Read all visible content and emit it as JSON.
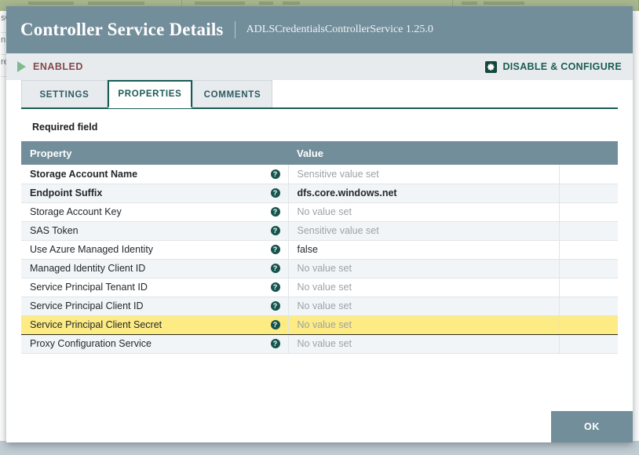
{
  "background": {
    "side_labels": [
      "sC",
      "n",
      "re"
    ],
    "topbar_color": "#a9b78f"
  },
  "modal": {
    "title": "Controller Service Details",
    "subtitle": "ADLSCredentialsControllerService 1.25.0",
    "header_color": "#728e9b"
  },
  "status": {
    "state_label": "ENABLED",
    "state_color": "#84494b",
    "play_icon": "play-triangle-icon",
    "action_label": "DISABLE & CONFIGURE",
    "action_icon": "gear-icon",
    "action_color": "#1d5b55"
  },
  "tabs": [
    {
      "label": "SETTINGS",
      "active": false
    },
    {
      "label": "PROPERTIES",
      "active": true
    },
    {
      "label": "COMMENTS",
      "active": false
    }
  ],
  "content": {
    "required_note": "Required field",
    "table": {
      "headers": [
        "Property",
        "Value",
        ""
      ],
      "help_icon_glyph": "?",
      "rows": [
        {
          "property": "Storage Account Name",
          "required": true,
          "value": "Sensitive value set",
          "value_state": "unset",
          "selected": false
        },
        {
          "property": "Endpoint Suffix",
          "required": true,
          "value": "dfs.core.windows.net",
          "value_state": "bold",
          "selected": false
        },
        {
          "property": "Storage Account Key",
          "required": false,
          "value": "No value set",
          "value_state": "unset",
          "selected": false
        },
        {
          "property": "SAS Token",
          "required": false,
          "value": "Sensitive value set",
          "value_state": "unset",
          "selected": false
        },
        {
          "property": "Use Azure Managed Identity",
          "required": false,
          "value": "false",
          "value_state": "normal",
          "selected": false
        },
        {
          "property": "Managed Identity Client ID",
          "required": false,
          "value": "No value set",
          "value_state": "unset",
          "selected": false
        },
        {
          "property": "Service Principal Tenant ID",
          "required": false,
          "value": "No value set",
          "value_state": "unset",
          "selected": false
        },
        {
          "property": "Service Principal Client ID",
          "required": false,
          "value": "No value set",
          "value_state": "unset",
          "selected": false
        },
        {
          "property": "Service Principal Client Secret",
          "required": false,
          "value": "No value set",
          "value_state": "unset",
          "selected": true
        },
        {
          "property": "Proxy Configuration Service",
          "required": false,
          "value": "No value set",
          "value_state": "unset",
          "selected": false
        }
      ]
    }
  },
  "footer": {
    "ok_label": "OK"
  }
}
